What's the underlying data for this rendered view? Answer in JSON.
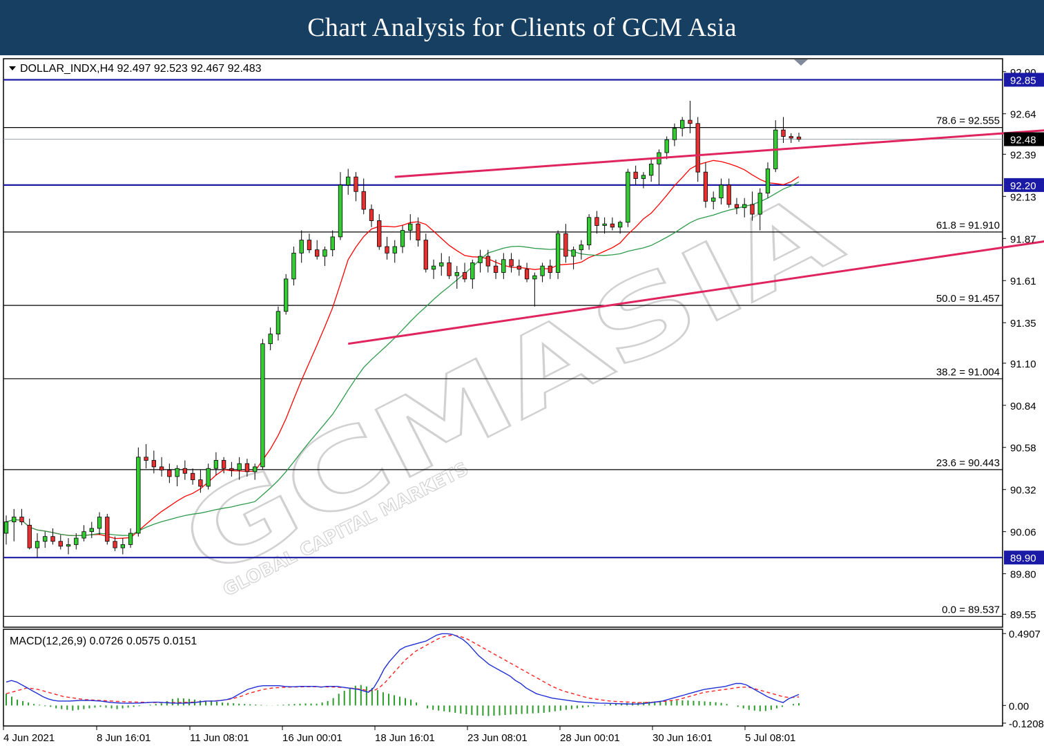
{
  "banner": {
    "title": "Chart Analysis for Clients of GCM Asia"
  },
  "chart_data": {
    "type": "candlestick",
    "symbol_header": "DOLLAR_INDX,H4  92.497 92.523 92.467 92.483",
    "indicator_header": "MACD(12,26,9) 0.0726 0.0575 0.0151",
    "price_axis": {
      "range": [
        89.47,
        92.98
      ],
      "ticks": [
        "92.90",
        "92.64",
        "92.39",
        "92.13",
        "91.87",
        "91.61",
        "91.35",
        "91.10",
        "90.84",
        "90.58",
        "90.32",
        "90.06",
        "89.80",
        "89.55"
      ]
    },
    "macd_axis": {
      "range": [
        -0.14,
        0.52
      ],
      "ticks": [
        "0.4907",
        "0.00",
        "-0.1208"
      ]
    },
    "x_labels": [
      "4 Jun 2021",
      "8 Jun 16:01",
      "11 Jun 08:01",
      "16 Jun 00:01",
      "18 Jun 16:01",
      "23 Jun 08:01",
      "28 Jun 00:01",
      "30 Jun 16:01",
      "5 Jul 08:01"
    ],
    "current_price_tag": "92.48",
    "current_price": 92.483,
    "horizontal_levels": [
      {
        "price": 92.85,
        "tag": "92.85",
        "color": "#1a1aa6"
      },
      {
        "price": 92.2,
        "tag": "92.20",
        "color": "#1a1aa6"
      },
      {
        "price": 89.9,
        "tag": "89.90",
        "color": "#1a1aa6"
      }
    ],
    "fibonacci_levels": [
      {
        "price": 92.555,
        "label": "78.6 = 92.555"
      },
      {
        "price": 91.91,
        "label": "61.8 = 91.910"
      },
      {
        "price": 91.457,
        "label": "50.0 = 91.457"
      },
      {
        "price": 91.004,
        "label": "38.2 = 91.004"
      },
      {
        "price": 90.443,
        "label": "23.6 = 90.443"
      },
      {
        "price": 89.537,
        "label": "0.0 = 89.537"
      }
    ],
    "channel_lines": [
      {
        "from": [
          50,
          92.25
        ],
        "to": [
          175,
          92.68
        ]
      },
      {
        "from": [
          44,
          91.22
        ],
        "to": [
          190,
          92.25
        ]
      }
    ],
    "ohlc": [
      [
        90.05,
        90.16,
        89.98,
        90.12
      ],
      [
        90.12,
        90.2,
        90.0,
        90.15
      ],
      [
        90.15,
        90.2,
        90.1,
        90.12
      ],
      [
        90.1,
        90.14,
        89.95,
        89.96
      ],
      [
        89.96,
        90.05,
        89.9,
        90.0
      ],
      [
        90.0,
        90.06,
        89.96,
        90.03
      ],
      [
        90.03,
        90.08,
        89.98,
        90.0
      ],
      [
        90.0,
        90.04,
        89.95,
        89.97
      ],
      [
        89.97,
        90.02,
        89.92,
        89.98
      ],
      [
        89.98,
        90.05,
        89.95,
        90.02
      ],
      [
        90.02,
        90.1,
        90.0,
        90.06
      ],
      [
        90.06,
        90.12,
        90.02,
        90.08
      ],
      [
        90.08,
        90.18,
        90.04,
        90.15
      ],
      [
        90.15,
        90.17,
        89.98,
        90.0
      ],
      [
        90.0,
        90.03,
        89.94,
        89.96
      ],
      [
        89.96,
        90.02,
        89.92,
        89.98
      ],
      [
        89.98,
        90.08,
        89.96,
        90.05
      ],
      [
        90.05,
        90.58,
        90.03,
        90.52
      ],
      [
        90.52,
        90.6,
        90.45,
        90.5
      ],
      [
        90.5,
        90.56,
        90.42,
        90.46
      ],
      [
        90.46,
        90.52,
        90.4,
        90.44
      ],
      [
        90.44,
        90.48,
        90.36,
        90.4
      ],
      [
        90.4,
        90.47,
        90.34,
        90.45
      ],
      [
        90.45,
        90.5,
        90.38,
        90.42
      ],
      [
        90.42,
        90.45,
        90.35,
        90.38
      ],
      [
        90.38,
        90.44,
        90.3,
        90.34
      ],
      [
        90.34,
        90.48,
        90.32,
        90.45
      ],
      [
        90.45,
        90.55,
        90.41,
        90.5
      ],
      [
        90.5,
        90.52,
        90.42,
        90.45
      ],
      [
        90.45,
        90.49,
        90.4,
        90.44
      ],
      [
        90.44,
        90.52,
        90.38,
        90.48
      ],
      [
        90.48,
        90.51,
        90.4,
        90.43
      ],
      [
        90.43,
        90.48,
        90.38,
        90.46
      ],
      [
        90.46,
        91.25,
        90.44,
        91.22
      ],
      [
        91.22,
        91.32,
        91.18,
        91.28
      ],
      [
        91.28,
        91.45,
        91.24,
        91.42
      ],
      [
        91.42,
        91.65,
        91.4,
        91.62
      ],
      [
        91.62,
        91.82,
        91.58,
        91.78
      ],
      [
        91.78,
        91.92,
        91.72,
        91.86
      ],
      [
        91.86,
        91.9,
        91.78,
        91.8
      ],
      [
        91.8,
        91.86,
        91.74,
        91.76
      ],
      [
        91.76,
        91.82,
        91.7,
        91.8
      ],
      [
        91.8,
        91.92,
        91.76,
        91.88
      ],
      [
        91.88,
        92.28,
        91.86,
        92.2
      ],
      [
        92.2,
        92.3,
        92.14,
        92.25
      ],
      [
        92.25,
        92.28,
        92.1,
        92.16
      ],
      [
        92.16,
        92.24,
        92.02,
        92.05
      ],
      [
        92.05,
        92.08,
        91.94,
        91.98
      ],
      [
        91.98,
        92.02,
        91.8,
        91.82
      ],
      [
        91.82,
        91.88,
        91.74,
        91.78
      ],
      [
        91.78,
        91.86,
        91.72,
        91.82
      ],
      [
        91.82,
        91.95,
        91.78,
        91.92
      ],
      [
        91.92,
        92.02,
        91.86,
        91.96
      ],
      [
        91.96,
        92.0,
        91.82,
        91.86
      ],
      [
        91.86,
        91.9,
        91.66,
        91.68
      ],
      [
        91.68,
        91.74,
        91.62,
        91.7
      ],
      [
        91.7,
        91.78,
        91.64,
        91.72
      ],
      [
        91.72,
        91.76,
        91.62,
        91.64
      ],
      [
        91.64,
        91.7,
        91.56,
        91.66
      ],
      [
        91.66,
        91.72,
        91.6,
        91.62
      ],
      [
        91.62,
        91.74,
        91.56,
        91.72
      ],
      [
        91.72,
        91.8,
        91.66,
        91.76
      ],
      [
        91.76,
        91.8,
        91.66,
        91.7
      ],
      [
        91.7,
        91.74,
        91.62,
        91.66
      ],
      [
        91.66,
        91.78,
        91.62,
        91.74
      ],
      [
        91.74,
        91.78,
        91.66,
        91.7
      ],
      [
        91.7,
        91.74,
        91.64,
        91.68
      ],
      [
        91.68,
        91.72,
        91.6,
        91.62
      ],
      [
        91.62,
        91.66,
        91.45,
        91.64
      ],
      [
        91.64,
        91.72,
        91.6,
        91.7
      ],
      [
        91.7,
        91.74,
        91.62,
        91.66
      ],
      [
        91.66,
        91.92,
        91.62,
        91.9
      ],
      [
        91.9,
        91.96,
        91.72,
        91.76
      ],
      [
        91.76,
        91.82,
        91.68,
        91.8
      ],
      [
        91.8,
        91.86,
        91.74,
        91.83
      ],
      [
        91.83,
        92.02,
        91.8,
        92.0
      ],
      [
        92.0,
        92.04,
        91.9,
        91.95
      ],
      [
        91.95,
        92.0,
        91.9,
        91.96
      ],
      [
        91.96,
        92.0,
        91.92,
        91.94
      ],
      [
        91.94,
        91.98,
        91.9,
        91.97
      ],
      [
        91.97,
        92.3,
        91.94,
        92.28
      ],
      [
        92.28,
        92.32,
        92.2,
        92.24
      ],
      [
        92.24,
        92.28,
        92.18,
        92.26
      ],
      [
        92.26,
        92.36,
        92.22,
        92.33
      ],
      [
        92.33,
        92.42,
        92.2,
        92.4
      ],
      [
        92.4,
        92.5,
        92.36,
        92.48
      ],
      [
        92.48,
        92.58,
        92.44,
        92.55
      ],
      [
        92.55,
        92.62,
        92.5,
        92.6
      ],
      [
        92.6,
        92.72,
        92.52,
        92.58
      ],
      [
        92.58,
        92.62,
        92.22,
        92.28
      ],
      [
        92.28,
        92.34,
        92.06,
        92.1
      ],
      [
        92.1,
        92.16,
        92.05,
        92.12
      ],
      [
        92.12,
        92.24,
        92.08,
        92.2
      ],
      [
        92.2,
        92.24,
        92.06,
        92.08
      ],
      [
        92.08,
        92.12,
        92.02,
        92.06
      ],
      [
        92.06,
        92.12,
        92.0,
        92.08
      ],
      [
        92.08,
        92.16,
        91.98,
        92.02
      ],
      [
        92.02,
        92.18,
        91.92,
        92.15
      ],
      [
        92.15,
        92.34,
        92.12,
        92.3
      ],
      [
        92.3,
        92.6,
        92.28,
        92.54
      ],
      [
        92.54,
        92.62,
        92.46,
        92.5
      ],
      [
        92.5,
        92.52,
        92.46,
        92.49
      ],
      [
        92.497,
        92.523,
        92.467,
        92.483
      ]
    ],
    "macd": {
      "histogram": [
        0.08,
        0.06,
        0.04,
        0.03,
        0.02,
        0.01,
        0.005,
        -0.005,
        -0.01,
        -0.02,
        -0.025,
        -0.03,
        -0.035,
        -0.03,
        -0.025,
        -0.02,
        -0.015,
        -0.01,
        -0.015,
        -0.02,
        -0.025,
        -0.02,
        -0.015,
        -0.01,
        -0.005,
        0.0,
        0.005,
        0.01,
        0.015,
        0.03,
        0.045,
        0.05,
        0.048,
        0.045,
        0.04,
        0.035,
        0.03,
        0.028,
        0.025,
        0.02,
        0.018,
        0.015,
        0.012,
        0.01,
        0.008,
        0.006,
        0.004,
        0.002,
        0.001,
        0.003,
        0.005,
        0.008,
        0.01,
        0.012,
        0.014,
        0.013,
        0.012,
        0.02,
        0.03,
        0.05,
        0.08,
        0.1,
        0.12,
        0.135,
        0.14,
        0.13,
        0.12,
        0.105,
        0.09,
        0.08,
        0.07,
        0.06,
        0.05,
        0.04,
        0.02,
        0.0,
        -0.02,
        -0.03,
        -0.035,
        -0.04,
        -0.045,
        -0.05,
        -0.055,
        -0.06,
        -0.065,
        -0.068,
        -0.07,
        -0.072,
        -0.07,
        -0.068,
        -0.065,
        -0.062,
        -0.06,
        -0.058,
        -0.056,
        -0.054,
        -0.052,
        -0.05,
        -0.045,
        -0.04,
        -0.035,
        -0.03,
        -0.025,
        -0.02,
        -0.015,
        -0.01,
        -0.005,
        0.0,
        0.005,
        0.01,
        0.012,
        0.015,
        0.018,
        0.02,
        0.022,
        0.024,
        0.026,
        0.028,
        0.03,
        0.032,
        0.033,
        0.034,
        0.035,
        0.034,
        0.032,
        0.03,
        0.028,
        0.025,
        0.022,
        0.018,
        0.01,
        0.0,
        -0.01,
        -0.02,
        -0.03,
        -0.035,
        -0.04,
        -0.038,
        -0.03,
        -0.02,
        -0.01,
        0.0,
        0.01,
        0.015
      ],
      "macd_line": [
        0.16,
        0.17,
        0.16,
        0.14,
        0.12,
        0.1,
        0.08,
        0.06,
        0.045,
        0.035,
        0.03,
        0.03,
        0.03,
        0.032,
        0.034,
        0.035,
        0.034,
        0.032,
        0.03,
        0.025,
        0.02,
        0.018,
        0.016,
        0.015,
        0.015,
        0.016,
        0.018,
        0.02,
        0.022,
        0.022,
        0.02,
        0.018,
        0.016,
        0.015,
        0.016,
        0.018,
        0.02,
        0.025,
        0.03,
        0.03,
        0.03,
        0.035,
        0.04,
        0.05,
        0.07,
        0.09,
        0.11,
        0.12,
        0.13,
        0.135,
        0.135,
        0.135,
        0.135,
        0.13,
        0.128,
        0.128,
        0.13,
        0.13,
        0.13,
        0.13,
        0.125,
        0.13,
        0.13,
        0.13,
        0.125,
        0.12,
        0.115,
        0.11,
        0.1,
        0.09,
        0.12,
        0.18,
        0.25,
        0.3,
        0.34,
        0.38,
        0.4,
        0.41,
        0.42,
        0.43,
        0.44,
        0.46,
        0.48,
        0.49,
        0.49,
        0.485,
        0.47,
        0.45,
        0.42,
        0.38,
        0.34,
        0.31,
        0.28,
        0.26,
        0.24,
        0.22,
        0.2,
        0.17,
        0.15,
        0.12,
        0.1,
        0.08,
        0.07,
        0.06,
        0.05,
        0.045,
        0.04,
        0.035,
        0.03,
        0.025,
        0.022,
        0.02,
        0.018,
        0.016,
        0.015,
        0.014,
        0.013,
        0.012,
        0.011,
        0.01,
        0.01,
        0.012,
        0.015,
        0.02,
        0.025,
        0.03,
        0.04,
        0.05,
        0.06,
        0.07,
        0.08,
        0.09,
        0.1,
        0.11,
        0.115,
        0.12,
        0.125,
        0.13,
        0.14,
        0.15,
        0.15,
        0.14,
        0.12,
        0.1,
        0.08,
        0.06,
        0.045,
        0.03,
        0.02,
        0.045,
        0.06,
        0.075
      ],
      "signal_line": [
        0.08,
        0.09,
        0.1,
        0.11,
        0.12,
        0.115,
        0.11,
        0.1,
        0.09,
        0.08,
        0.07,
        0.06,
        0.055,
        0.05,
        0.045,
        0.04,
        0.038,
        0.036,
        0.034,
        0.032,
        0.03,
        0.028,
        0.026,
        0.025,
        0.024,
        0.023,
        0.022,
        0.021,
        0.02,
        0.02,
        0.02,
        0.02,
        0.02,
        0.02,
        0.021,
        0.022,
        0.023,
        0.025,
        0.028,
        0.03,
        0.032,
        0.035,
        0.04,
        0.045,
        0.055,
        0.065,
        0.08,
        0.09,
        0.1,
        0.11,
        0.115,
        0.12,
        0.122,
        0.124,
        0.125,
        0.126,
        0.127,
        0.128,
        0.128,
        0.128,
        0.127,
        0.127,
        0.126,
        0.125,
        0.123,
        0.12,
        0.117,
        0.113,
        0.108,
        0.1,
        0.1,
        0.12,
        0.15,
        0.19,
        0.23,
        0.27,
        0.31,
        0.34,
        0.37,
        0.39,
        0.41,
        0.43,
        0.45,
        0.465,
        0.475,
        0.48,
        0.475,
        0.465,
        0.45,
        0.43,
        0.41,
        0.39,
        0.37,
        0.35,
        0.33,
        0.31,
        0.29,
        0.27,
        0.25,
        0.23,
        0.21,
        0.19,
        0.17,
        0.15,
        0.13,
        0.115,
        0.1,
        0.09,
        0.08,
        0.07,
        0.06,
        0.05,
        0.045,
        0.04,
        0.035,
        0.03,
        0.028,
        0.026,
        0.024,
        0.022,
        0.02,
        0.02,
        0.021,
        0.022,
        0.024,
        0.027,
        0.03,
        0.035,
        0.04,
        0.05,
        0.06,
        0.07,
        0.08,
        0.09,
        0.095,
        0.1,
        0.105,
        0.11,
        0.115,
        0.12,
        0.125,
        0.125,
        0.12,
        0.11,
        0.1,
        0.09,
        0.08,
        0.07,
        0.06,
        0.055,
        0.055,
        0.058
      ]
    }
  },
  "watermark": {
    "logo": "GCMASIA",
    "tagline": "GLOBAL CAPITAL MARKETS"
  },
  "colors": {
    "up_candle": "#33cc33",
    "down_candle": "#e83030",
    "ma_fast": "#ff0000",
    "ma_slow": "#2e9a4a",
    "channel": "#e0245e",
    "macd_line": "#1f2fd6",
    "signal_line": "#ff2020",
    "histogram": "#2a9a2a",
    "level_line": "#1a1aa6",
    "tag_bg": "#1a1aa6"
  }
}
